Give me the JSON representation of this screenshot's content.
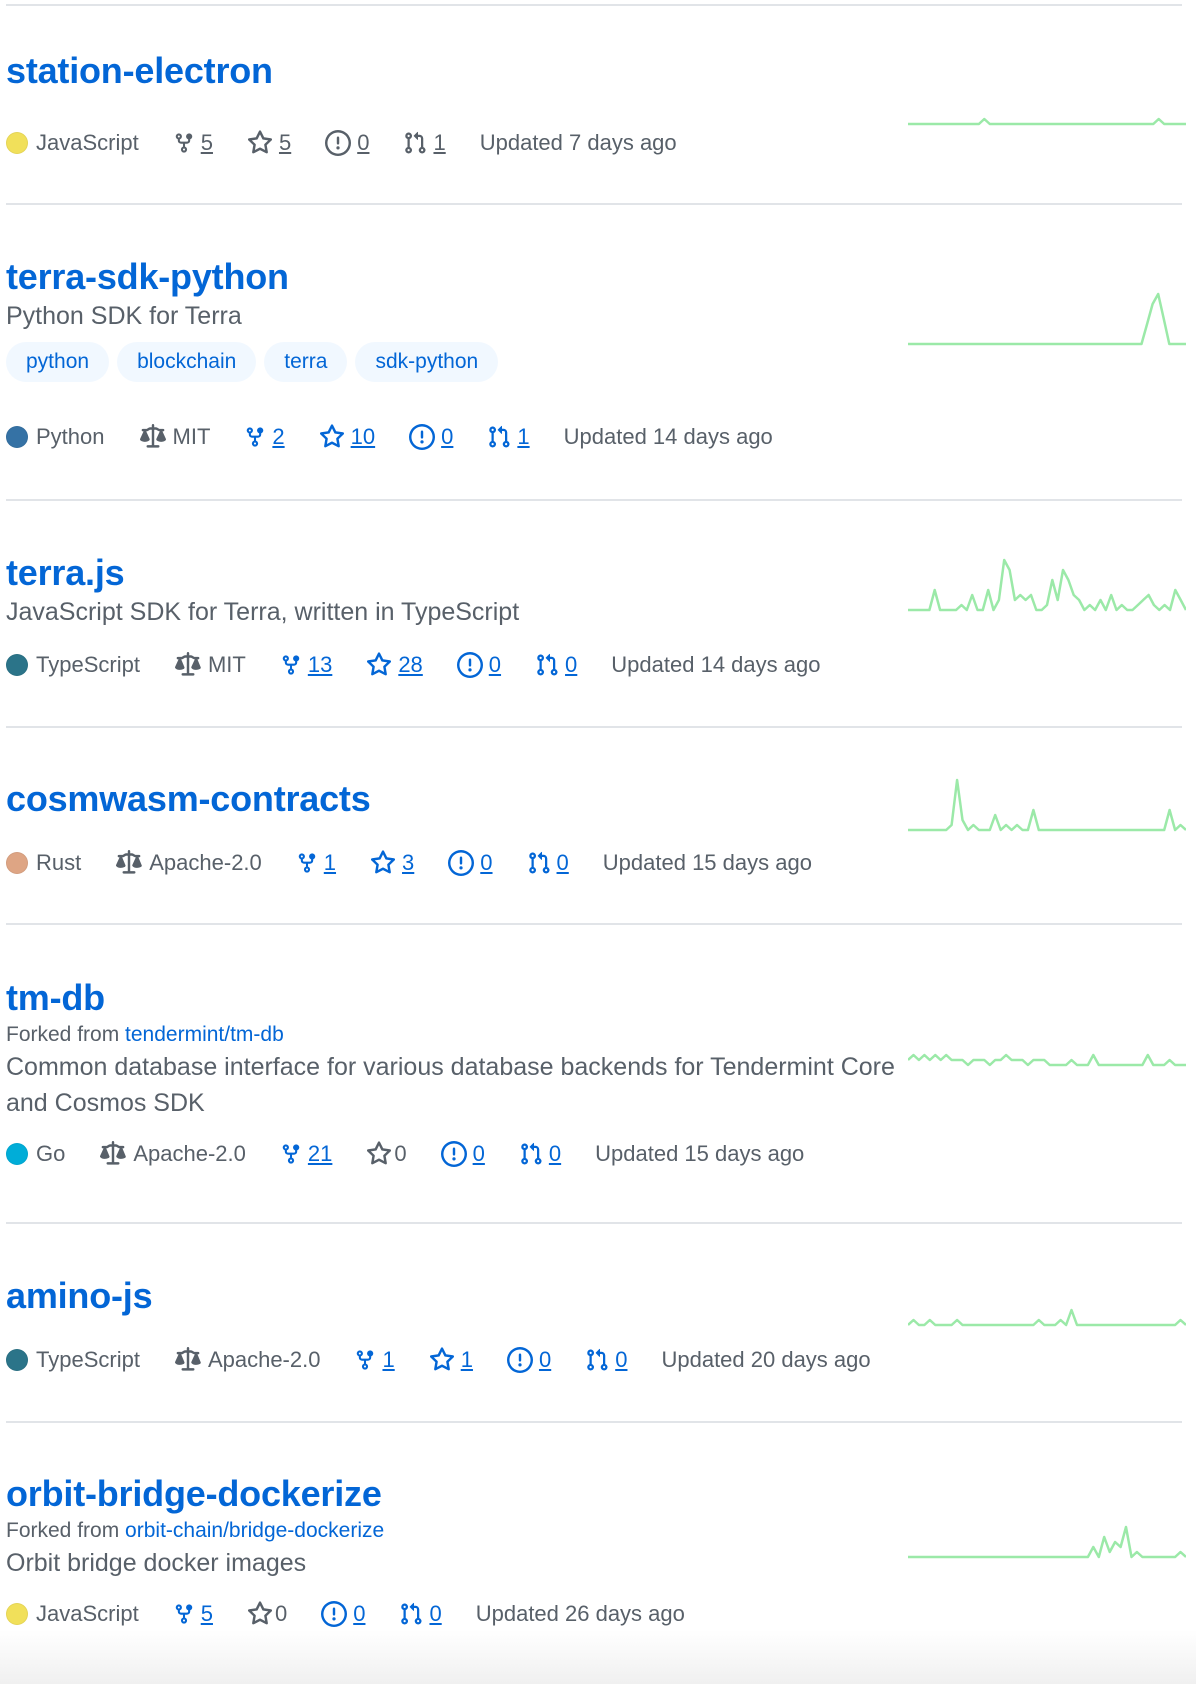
{
  "colors": {
    "link": "#0366d6",
    "muted": "#586069",
    "divider": "#e1e4e8",
    "spark": "#9be9a8",
    "spark_dark": "#40c463"
  },
  "languages": {
    "JavaScript": "#f1e05a",
    "Python": "#3572A5",
    "TypeScript": "#2b7489",
    "Rust": "#dea584",
    "Go": "#00ADD8"
  },
  "repos": [
    {
      "name": "station-electron",
      "language": "JavaScript",
      "language_color": "#f1e05a",
      "forks": "5",
      "stars": "5",
      "issues": "0",
      "prs": "1",
      "updated": "Updated 7 days ago",
      "activity": [
        0,
        0,
        0,
        0,
        0,
        0,
        0,
        0,
        0,
        0,
        0,
        0,
        0,
        0,
        1,
        0,
        0,
        0,
        0,
        0,
        0,
        0,
        0,
        0,
        0,
        0,
        0,
        0,
        0,
        0,
        0,
        0,
        0,
        0,
        0,
        0,
        0,
        0,
        0,
        0,
        0,
        0,
        0,
        0,
        0,
        0,
        1,
        0,
        0,
        0,
        0,
        0
      ]
    },
    {
      "name": "terra-sdk-python",
      "description": "Python SDK for Terra",
      "topics": [
        "python",
        "blockchain",
        "terra",
        "sdk-python"
      ],
      "language": "Python",
      "language_color": "#3572A5",
      "license": "MIT",
      "forks": "2",
      "stars": "10",
      "issues": "0",
      "prs": "1",
      "updated": "Updated 14 days ago",
      "activity": [
        0,
        0,
        0,
        0,
        0,
        0,
        0,
        0,
        0,
        0,
        0,
        0,
        0,
        0,
        0,
        0,
        0,
        0,
        0,
        0,
        0,
        0,
        0,
        0,
        0,
        0,
        0,
        0,
        0,
        0,
        0,
        0,
        0,
        0,
        0,
        0,
        0,
        0,
        0,
        0,
        0,
        0,
        0,
        4,
        8,
        10,
        5,
        0,
        0,
        0,
        0
      ]
    },
    {
      "name": "terra.js",
      "description": "JavaScript SDK for Terra, written in TypeScript",
      "language": "TypeScript",
      "language_color": "#2b7489",
      "license": "MIT",
      "forks": "13",
      "stars": "28",
      "issues": "0",
      "prs": "0",
      "updated": "Updated 14 days ago",
      "activity": [
        0,
        0,
        0,
        0,
        0,
        4,
        0,
        0,
        0,
        0,
        1,
        0,
        3,
        0,
        0,
        4,
        0,
        2,
        10,
        8,
        2,
        3,
        2,
        3,
        0,
        0,
        1,
        6,
        2,
        8,
        6,
        3,
        2,
        0,
        1,
        0,
        2,
        0,
        3,
        0,
        1,
        0,
        0,
        1,
        2,
        3,
        1,
        0,
        1,
        0,
        4,
        2,
        0
      ]
    },
    {
      "name": "cosmwasm-contracts",
      "language": "Rust",
      "language_color": "#dea584",
      "license": "Apache-2.0",
      "forks": "1",
      "stars": "3",
      "issues": "0",
      "prs": "0",
      "updated": "Updated 15 days ago",
      "activity": [
        0,
        0,
        0,
        0,
        0,
        0,
        0,
        0,
        1,
        10,
        2,
        0,
        1,
        0,
        0,
        0,
        3,
        0,
        1,
        0,
        1,
        0,
        0,
        4,
        0,
        0,
        0,
        0,
        0,
        0,
        0,
        0,
        0,
        0,
        0,
        0,
        0,
        0,
        0,
        0,
        0,
        0,
        0,
        0,
        0,
        0,
        0,
        0,
        4,
        0,
        1,
        0
      ]
    },
    {
      "name": "tm-db",
      "forked_prefix": "Forked from",
      "forked_from": "tendermint/tm-db",
      "description": "Common database interface for various database backends for Tendermint Core and Cosmos SDK",
      "language": "Go",
      "language_color": "#00ADD8",
      "license": "Apache-2.0",
      "forks": "21",
      "stars": "0",
      "issues": "0",
      "prs": "0",
      "updated": "Updated 15 days ago",
      "activity": [
        1,
        2,
        1,
        2,
        1,
        2,
        1,
        2,
        1,
        1,
        1,
        0,
        1,
        1,
        1,
        0,
        1,
        1,
        2,
        1,
        1,
        1,
        0,
        1,
        1,
        1,
        0,
        0,
        0,
        0,
        1,
        0,
        0,
        0,
        2,
        0,
        0,
        0,
        0,
        0,
        0,
        0,
        0,
        0,
        2,
        0,
        0,
        0,
        1,
        0,
        0,
        0
      ]
    },
    {
      "name": "amino-js",
      "language": "TypeScript",
      "language_color": "#2b7489",
      "license": "Apache-2.0",
      "forks": "1",
      "stars": "1",
      "issues": "0",
      "prs": "0",
      "updated": "Updated 20 days ago",
      "activity": [
        0,
        1,
        0,
        0,
        1,
        0,
        0,
        0,
        0,
        1,
        0,
        0,
        0,
        0,
        0,
        0,
        0,
        0,
        0,
        0,
        0,
        0,
        0,
        0,
        1,
        0,
        0,
        0,
        1,
        0,
        3,
        0,
        0,
        0,
        0,
        0,
        0,
        0,
        0,
        0,
        0,
        0,
        0,
        0,
        0,
        0,
        0,
        0,
        0,
        0,
        1,
        0
      ]
    },
    {
      "name": "orbit-bridge-dockerize",
      "forked_prefix": "Forked from",
      "forked_from": "orbit-chain/bridge-dockerize",
      "description": "Orbit bridge docker images",
      "language": "JavaScript",
      "language_color": "#f1e05a",
      "forks": "5",
      "stars": "0",
      "issues": "0",
      "prs": "0",
      "updated": "Updated 26 days ago",
      "activity": [
        0,
        0,
        0,
        0,
        0,
        0,
        0,
        0,
        0,
        0,
        0,
        0,
        0,
        0,
        0,
        0,
        0,
        0,
        0,
        0,
        0,
        0,
        0,
        0,
        0,
        0,
        0,
        0,
        0,
        0,
        0,
        0,
        0,
        0,
        2,
        0,
        4,
        1,
        3,
        2,
        6,
        0,
        1,
        0,
        0,
        0,
        0,
        0,
        0,
        0,
        1,
        0
      ]
    }
  ]
}
